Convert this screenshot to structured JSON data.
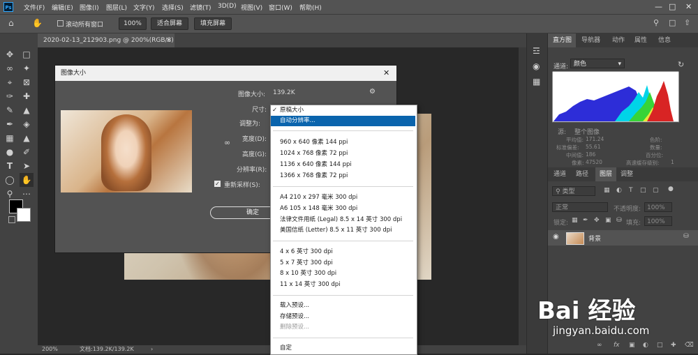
{
  "app": {
    "logo": "Ps"
  },
  "menubar": {
    "items": [
      "文件(F)",
      "编辑(E)",
      "图像(I)",
      "图层(L)",
      "文字(Y)",
      "选择(S)",
      "滤镜(T)",
      "3D(D)",
      "视图(V)",
      "窗口(W)",
      "帮助(H)"
    ]
  },
  "options": {
    "scroll_all": "滚动所有窗口",
    "zoom": "100%",
    "fit_screen": "适合屏幕",
    "fill_screen": "填充屏幕"
  },
  "document": {
    "tab_title": "2020-02-13_212903.png @ 200%(RGB/8)",
    "close": "×",
    "status_zoom": "200%",
    "status_doc": "文档:139.2K/139.2K"
  },
  "dialog": {
    "title": "图像大小",
    "close": "✕",
    "image_size_label": "图像大小:",
    "image_size_value": "139.2K",
    "dimensions_label": "尺寸:",
    "fit_to_label": "调整为:",
    "width_label": "宽度(D):",
    "height_label": "高度(G):",
    "resolution_label": "分辨率(R):",
    "resample_label": "重新采样(S):",
    "ok_label": "确定"
  },
  "dropdown": {
    "check_mark": "✓",
    "groups": [
      [
        "原稿大小",
        "自动分辨率..."
      ],
      [
        "960 x 640 像素 144 ppi",
        "1024 x 768 像素 72 ppi",
        "1136 x 640 像素 144 ppi",
        "1366 x 768 像素 72 ppi"
      ],
      [
        "A4 210 x 297 毫米 300 dpi",
        "A6 105 x 148 毫米 300 dpi",
        "法律文件用纸 (Legal) 8.5 x 14 英寸 300 dpi",
        "美国信纸 (Letter) 8.5 x 11 英寸 300 dpi"
      ],
      [
        "4 x 6 英寸 300 dpi",
        "5 x 7 英寸 300 dpi",
        "8 x 10 英寸 300 dpi",
        "11 x 14 英寸 300 dpi"
      ],
      [
        "载入预设...",
        "存储预设...",
        "删除预设..."
      ],
      [
        "自定"
      ]
    ],
    "checked_item": "原稿大小",
    "selected_item": "自动分辨率...",
    "disabled_item": "删除预设..."
  },
  "histogram_panel": {
    "tabs": [
      "直方图",
      "导航器",
      "动作",
      "属性",
      "信息"
    ],
    "channel_label": "通道:",
    "channel_value": "颜色",
    "source_label": "源:",
    "source_value": "整个图像",
    "stats_left": [
      [
        "平均值:",
        "171.24"
      ],
      [
        "标准偏差:",
        "55.61"
      ],
      [
        "中间值:",
        "186"
      ],
      [
        "像素:",
        "47520"
      ]
    ],
    "stats_right": [
      "色阶:",
      "数量:",
      "百分位:",
      "高速缓存级别:"
    ],
    "cache_level": "1"
  },
  "layers_panel": {
    "tabs": [
      "通道",
      "路径",
      "图层",
      "调整"
    ],
    "filter_kind": "类型",
    "blend_mode": "正常",
    "opacity_label": "不透明度:",
    "opacity_value": "100%",
    "lock_label": "锁定:",
    "fill_label": "填充:",
    "fill_value": "100%",
    "layer_name": "背景"
  },
  "watermark": {
    "brand": "Bai 经验",
    "url": "jingyan.baidu.com"
  },
  "colors": {
    "accent": "#0a64ad",
    "panel": "#424242",
    "menubar": "#535353"
  }
}
